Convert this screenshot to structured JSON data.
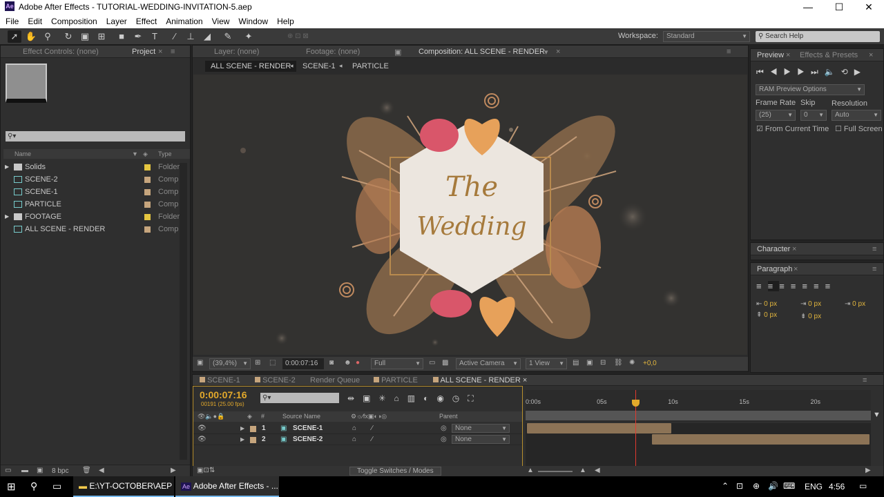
{
  "window": {
    "title": "Adobe After Effects - TUTORIAL-WEDDING-INVITATION-5.aep",
    "app_badge": "Ae",
    "min": "—",
    "max": "☐",
    "close": "✕"
  },
  "menu": [
    "File",
    "Edit",
    "Composition",
    "Layer",
    "Effect",
    "Animation",
    "View",
    "Window",
    "Help"
  ],
  "toolbar": {
    "workspace_label": "Workspace:",
    "workspace_value": "Standard",
    "search_placeholder": "Search Help"
  },
  "left_panel": {
    "tab_effect_controls": "Effect Controls: (none)",
    "tab_project": "Project",
    "col_name": "Name",
    "col_type": "Type",
    "bpc": "8 bpc",
    "items": [
      {
        "name": "Solids",
        "type": "Folder",
        "color": "#e5c640",
        "kind": "folder"
      },
      {
        "name": "SCENE-2",
        "type": "Comp",
        "color": "#c6a57d",
        "kind": "comp"
      },
      {
        "name": "SCENE-1",
        "type": "Comp",
        "color": "#c6a57d",
        "kind": "comp"
      },
      {
        "name": "PARTICLE",
        "type": "Comp",
        "color": "#c6a57d",
        "kind": "comp"
      },
      {
        "name": "FOOTAGE",
        "type": "Folder",
        "color": "#e5c640",
        "kind": "folder"
      },
      {
        "name": "ALL SCENE - RENDER",
        "type": "Comp",
        "color": "#c6a57d",
        "kind": "comp"
      }
    ]
  },
  "viewer": {
    "tab_layer": "Layer: (none)",
    "tab_footage": "Footage: (none)",
    "tab_comp": "Composition: ALL SCENE - RENDER",
    "breadcrumbs": [
      "ALL SCENE - RENDER",
      "SCENE-1",
      "PARTICLE"
    ],
    "text_line1": "The",
    "text_line2": "Wedding",
    "zoom": "(39,4%)",
    "timecode": "0:00:07:16",
    "resolution": "Full",
    "camera": "Active Camera",
    "views": "1 View",
    "exposure": "+0,0"
  },
  "right_panel": {
    "tab_preview": "Preview",
    "tab_effects": "Effects & Presets",
    "ram_preview": "RAM Preview Options",
    "frame_rate_label": "Frame Rate",
    "skip_label": "Skip",
    "resolution_label": "Resolution",
    "frame_rate": "(25)",
    "skip": "0",
    "resolution": "Auto",
    "from_current": "From Current Time",
    "full_screen": "Full Screen",
    "character": "Character",
    "paragraph": "Paragraph",
    "px": [
      "0 px",
      "0 px",
      "0 px",
      "0 px",
      "0 px"
    ]
  },
  "timeline": {
    "tabs": [
      "SCENE-1",
      "SCENE-2",
      "Render Queue",
      "PARTICLE",
      "ALL SCENE - RENDER"
    ],
    "current_time": "0:00:07:16",
    "frame_info": "00191 (25.00 fps)",
    "col_source": "Source Name",
    "col_parent": "Parent",
    "hash": "#",
    "ruler": [
      "0:00s",
      "05s",
      "10s",
      "15s",
      "20s"
    ],
    "playhead_seconds": 7.64,
    "duration_seconds": 24,
    "layers": [
      {
        "num": "1",
        "name": "SCENE-1",
        "parent": "None",
        "start": 0,
        "end": 10.2
      },
      {
        "num": "2",
        "name": "SCENE-2",
        "parent": "None",
        "start": 8.7,
        "end": 24
      }
    ],
    "toggle_label": "Toggle Switches / Modes"
  },
  "taskbar": {
    "explorer_label": "E:\\YT-OCTOBER\\AEP",
    "ae_label": "Adobe After Effects - ...",
    "lang": "ENG",
    "clock": "4:56"
  }
}
